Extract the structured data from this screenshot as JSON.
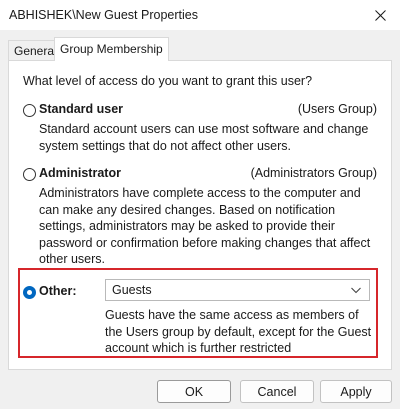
{
  "window": {
    "title": "ABHISHEK\\New Guest Properties"
  },
  "tabs": [
    {
      "label": "General",
      "selected": false
    },
    {
      "label": "Group Membership",
      "selected": true
    }
  ],
  "panel": {
    "question": "What level of access do you want to grant this user?",
    "options": {
      "standard": {
        "label": "Standard user",
        "group": "(Users Group)",
        "desc": "Standard account users can use most software and change system settings that do not affect other users.",
        "checked": false
      },
      "administrator": {
        "label": "Administrator",
        "group": "(Administrators Group)",
        "desc": "Administrators have complete access to the computer and can make any desired changes. Based on notification settings, administrators may be asked to provide their password or confirmation before making changes that affect other users.",
        "checked": false
      },
      "other": {
        "label": "Other:",
        "selected_value": "Guests",
        "desc": "Guests have the same access as members of the Users group by default, except for the Guest account which is further restricted",
        "checked": true
      }
    }
  },
  "buttons": {
    "ok": "OK",
    "cancel": "Cancel",
    "apply": "Apply"
  },
  "colors": {
    "accent": "#0067c0",
    "highlight_border": "#d6262b"
  }
}
